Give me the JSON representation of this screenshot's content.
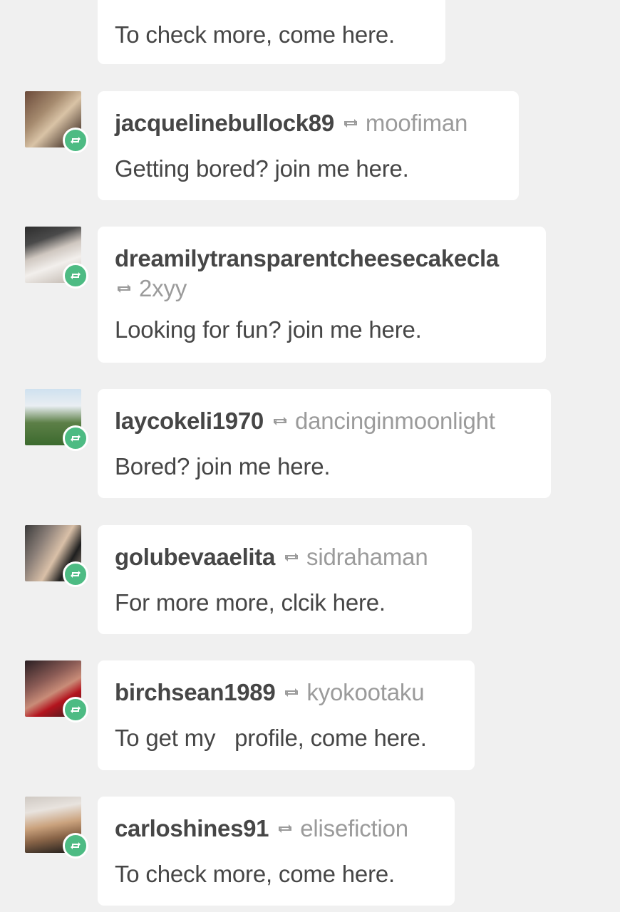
{
  "colors": {
    "background": "#f0f0f0",
    "card": "#ffffff",
    "username": "#464646",
    "source": "#9b9b9b",
    "reblog_badge": "#4dbb83"
  },
  "icons": {
    "reblog": "reblog-icon"
  },
  "posts": [
    {
      "message": "To check more, come here."
    },
    {
      "username": "jacquelinebullock89",
      "source": "moofiman",
      "message": "Getting bored? join me here."
    },
    {
      "username": "dreamilytransparentcheesecakecla",
      "source": "2xyy",
      "message": "Looking for fun? join me here."
    },
    {
      "username": "laycokeli1970",
      "source": "dancinginmoonlight",
      "message": "Bored? join me here."
    },
    {
      "username": "golubevaaelita",
      "source": "sidrahaman",
      "message": "For more more, clcik here."
    },
    {
      "username": "birchsean1989",
      "source": "kyokootaku",
      "message": "To get my   profile, come here."
    },
    {
      "username": "carloshines91",
      "source": "elisefiction",
      "message": "To check more, come here."
    }
  ]
}
